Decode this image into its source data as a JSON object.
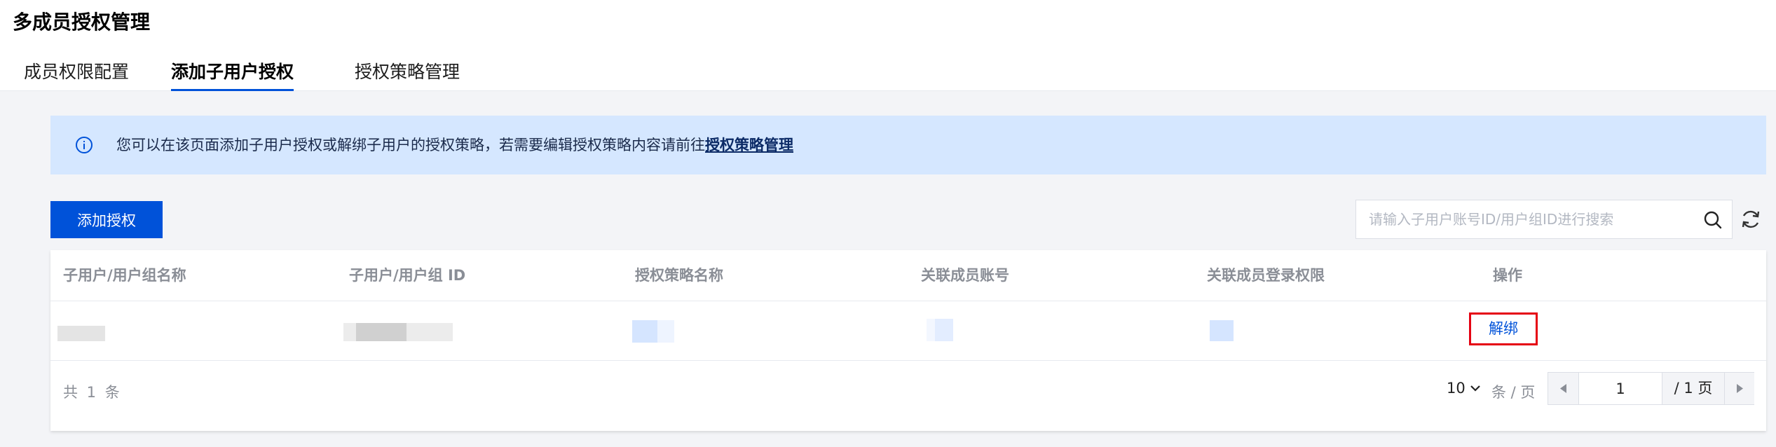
{
  "page": {
    "title": "多成员授权管理"
  },
  "tabs": [
    {
      "label": "成员权限配置",
      "active": false
    },
    {
      "label": "添加子用户授权",
      "active": true
    },
    {
      "label": "授权策略管理",
      "active": false
    }
  ],
  "notice": {
    "text": "您可以在该页面添加子用户授权或解绑子用户的授权策略，若需要编辑授权策略内容请前往",
    "link": "授权策略管理",
    "icon": "info-icon"
  },
  "toolbar": {
    "add_label": "添加授权",
    "search_placeholder": "请输入子用户账号ID/用户组ID进行搜索"
  },
  "table": {
    "columns": [
      "子用户/用户组名称",
      "子用户/用户组 ID",
      "授权策略名称",
      "关联成员账号",
      "关联成员登录权限",
      "操作"
    ],
    "rows": [
      {
        "action": "解绑"
      }
    ]
  },
  "footer": {
    "total": "共 1 条",
    "page_size": "10",
    "per_page_label": "条 / 页",
    "current_page": "1",
    "total_pages_label": "/ 1 页"
  },
  "colors": {
    "primary": "#0052d9",
    "notice_bg": "#d5e7ff",
    "highlight": "#e50012"
  }
}
